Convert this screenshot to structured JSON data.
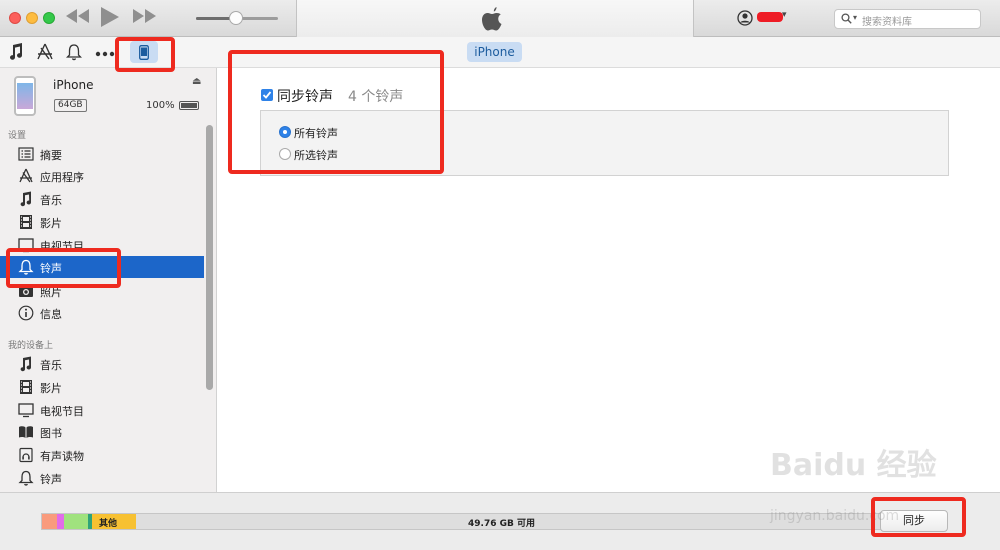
{
  "search": {
    "placeholder": "搜索资料库"
  },
  "toolbar": {
    "icons": [
      "music-icon",
      "app-store-icon",
      "bell-icon",
      "more-icon",
      "device-icon"
    ],
    "device_tab": "iPhone"
  },
  "device": {
    "name": "iPhone",
    "capacity": "64GB",
    "battery": "100%"
  },
  "sidebar": {
    "settings_header": "设置",
    "settings_items": [
      {
        "label": "摘要",
        "icon": "summary-icon"
      },
      {
        "label": "应用程序",
        "icon": "apps-icon"
      },
      {
        "label": "音乐",
        "icon": "music-icon"
      },
      {
        "label": "影片",
        "icon": "film-icon"
      },
      {
        "label": "电视节目",
        "icon": "tv-icon"
      },
      {
        "label": "铃声",
        "icon": "bell-icon",
        "selected": true
      },
      {
        "label": "照片",
        "icon": "camera-icon"
      },
      {
        "label": "信息",
        "icon": "info-icon"
      }
    ],
    "ondevice_header": "我的设备上",
    "ondevice_items": [
      {
        "label": "音乐",
        "icon": "music-icon"
      },
      {
        "label": "影片",
        "icon": "film-icon"
      },
      {
        "label": "电视节目",
        "icon": "tv-icon"
      },
      {
        "label": "图书",
        "icon": "book-icon"
      },
      {
        "label": "有声读物",
        "icon": "audiobook-icon"
      },
      {
        "label": "铃声",
        "icon": "bell-icon"
      }
    ]
  },
  "main": {
    "sync_label": "同步铃声",
    "sync_count": "4 个铃声",
    "sync_checked": true,
    "options": [
      {
        "label": "所有铃声",
        "selected": true
      },
      {
        "label": "所选铃声",
        "selected": false
      }
    ]
  },
  "storage": {
    "other_label": "其他",
    "free_label": "49.76 GB 可用",
    "colors": {
      "audio": "#f99b7d",
      "video": "#e16ce9",
      "photos": "#a0e27e",
      "apps": "#2fa37a",
      "other": "#f7c132",
      "free": "#dedede"
    }
  },
  "footer": {
    "sync_button": "同步"
  },
  "watermark": {
    "text": "Baidu 经验",
    "sub": "jingyan.baidu.com"
  },
  "colors": {
    "accent": "#1c66c9",
    "highlight": "#ee2a1f"
  }
}
